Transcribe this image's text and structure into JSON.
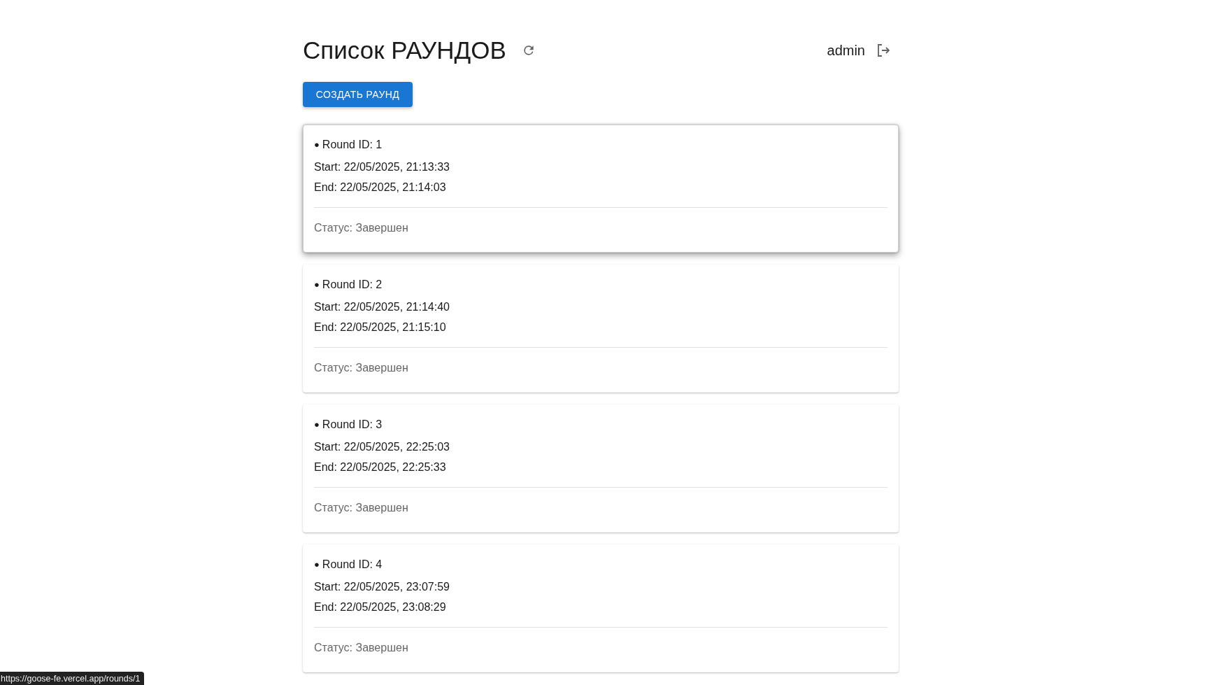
{
  "header": {
    "title": "Список РАУНДОВ",
    "user": "admin"
  },
  "create_button": "СОЗДАТЬ РАУНД",
  "rounds": [
    {
      "bullet": "●",
      "id_label": "Round ID: 1",
      "start": "Start: 22/05/2025, 21:13:33",
      "end": "End: 22/05/2025, 21:14:03",
      "status": "Статус: Завершен",
      "hovered": true
    },
    {
      "bullet": "●",
      "id_label": "Round ID: 2",
      "start": "Start: 22/05/2025, 21:14:40",
      "end": "End: 22/05/2025, 21:15:10",
      "status": "Статус: Завершен",
      "hovered": false
    },
    {
      "bullet": "●",
      "id_label": "Round ID: 3",
      "start": "Start: 22/05/2025, 22:25:03",
      "end": "End: 22/05/2025, 22:25:33",
      "status": "Статус: Завершен",
      "hovered": false
    },
    {
      "bullet": "●",
      "id_label": "Round ID: 4",
      "start": "Start: 22/05/2025, 23:07:59",
      "end": "End: 22/05/2025, 23:08:29",
      "status": "Статус: Завершен",
      "hovered": false
    }
  ],
  "link_preview": "https://goose-fe.vercel.app/rounds/1"
}
